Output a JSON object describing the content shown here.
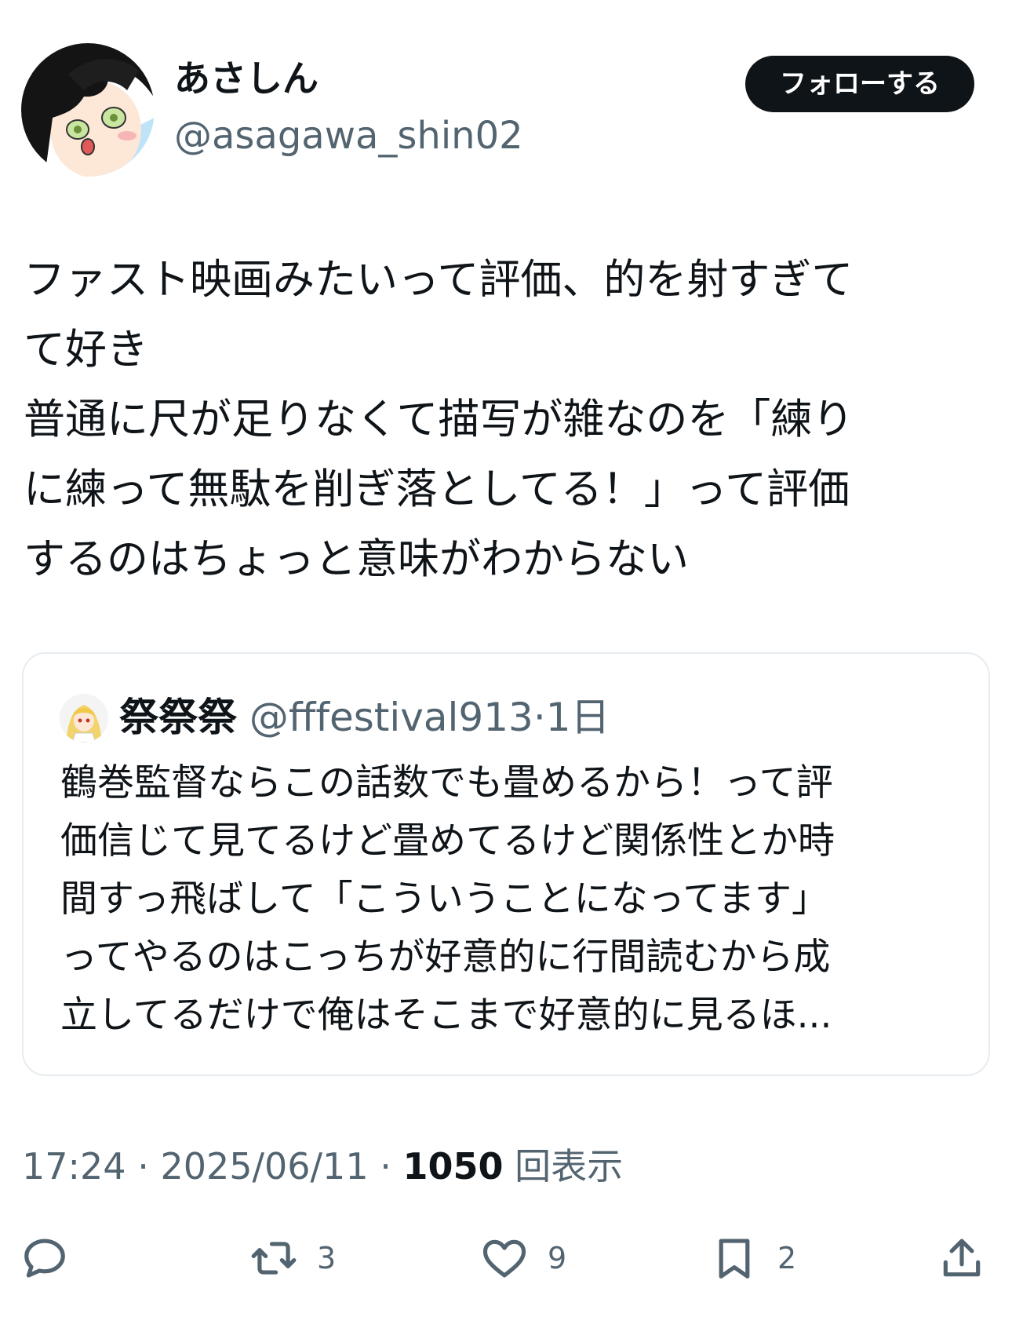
{
  "user": {
    "display_name": "あさしん",
    "handle": "@asagawa_shin02",
    "avatar_icon": "avatar-anime-girl"
  },
  "follow_label": "フォローする",
  "tweet": {
    "lines": [
      "ファスト映画みたいって評価、的を射すぎて",
      "て好き",
      "普通に尺が足りなくて描写が雑なのを「練り",
      "に練って無駄を削ぎ落としてる！」って評価",
      "するのはちょっと意味がわからない"
    ]
  },
  "quote": {
    "name": "祭祭祭",
    "handle": "@fffestival913",
    "separator": "·",
    "time": "1日",
    "lines": [
      "鶴巻監督ならこの話数でも畳めるから！って評",
      "価信じて見てるけど畳めてるけど関係性とか時",
      "間すっ飛ばして「こういうことになってます」",
      "ってやるのはこっちが好意的に行間読むから成",
      "立してるだけで俺はそこまで好意的に見るほ..."
    ]
  },
  "meta": {
    "time": "17:24",
    "sep1": " · ",
    "date": "2025/06/11",
    "sep2": " · ",
    "views": "1050",
    "views_label": " 回表示"
  },
  "actions": {
    "reply_icon": "reply-icon",
    "retweet_count": "3",
    "like_count": "9",
    "bookmark_count": "2",
    "share_icon": "share-icon"
  },
  "colors": {
    "text": "#0f1419",
    "muted": "#536471",
    "border": "#e6ecf0",
    "button_bg": "#0f1419"
  }
}
